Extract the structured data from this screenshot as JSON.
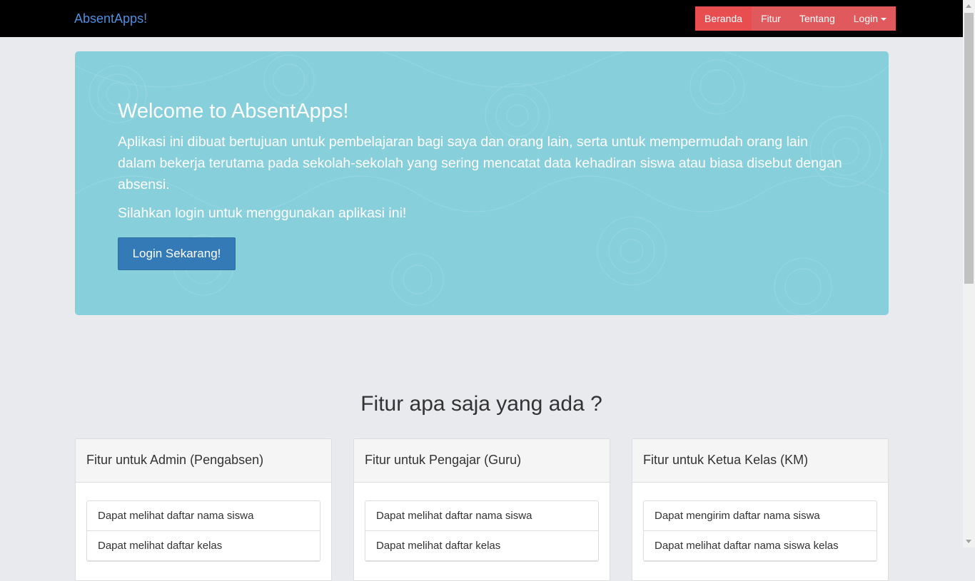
{
  "nav": {
    "brand": "AbsentApps!",
    "items": [
      {
        "label": "Beranda"
      },
      {
        "label": "Fitur"
      },
      {
        "label": "Tentang"
      },
      {
        "label": "Login"
      }
    ]
  },
  "jumbotron": {
    "title": "Welcome to AbsentApps!",
    "text": "Aplikasi ini dibuat bertujuan untuk pembelajaran bagi saya dan orang lain, serta untuk mempermudah orang lain dalam bekerja terutama pada sekolah-sekolah yang sering mencatat data kehadiran siswa atau biasa disebut dengan absensi.",
    "subtext": "Silahkan login untuk menggunakan aplikasi ini!",
    "button": "Login Sekarang!"
  },
  "features": {
    "title": "Fitur apa saja yang ada ?",
    "panels": [
      {
        "heading": "Fitur untuk Admin (Pengabsen)",
        "items": [
          "Dapat melihat daftar nama siswa",
          "Dapat melihat daftar kelas"
        ]
      },
      {
        "heading": "Fitur untuk Pengajar (Guru)",
        "items": [
          "Dapat melihat daftar nama siswa",
          "Dapat melihat daftar kelas"
        ]
      },
      {
        "heading": "Fitur untuk Ketua Kelas (KM)",
        "items": [
          "Dapat mengirim daftar nama siswa",
          "Dapat melihat daftar nama siswa kelas"
        ]
      }
    ]
  },
  "colors": {
    "navbar": "#000000",
    "brand": "#4d8fe0",
    "nav_accent": "#e05a5d",
    "jumbotron": "#86cfdb",
    "primary_button": "#337ab7"
  }
}
